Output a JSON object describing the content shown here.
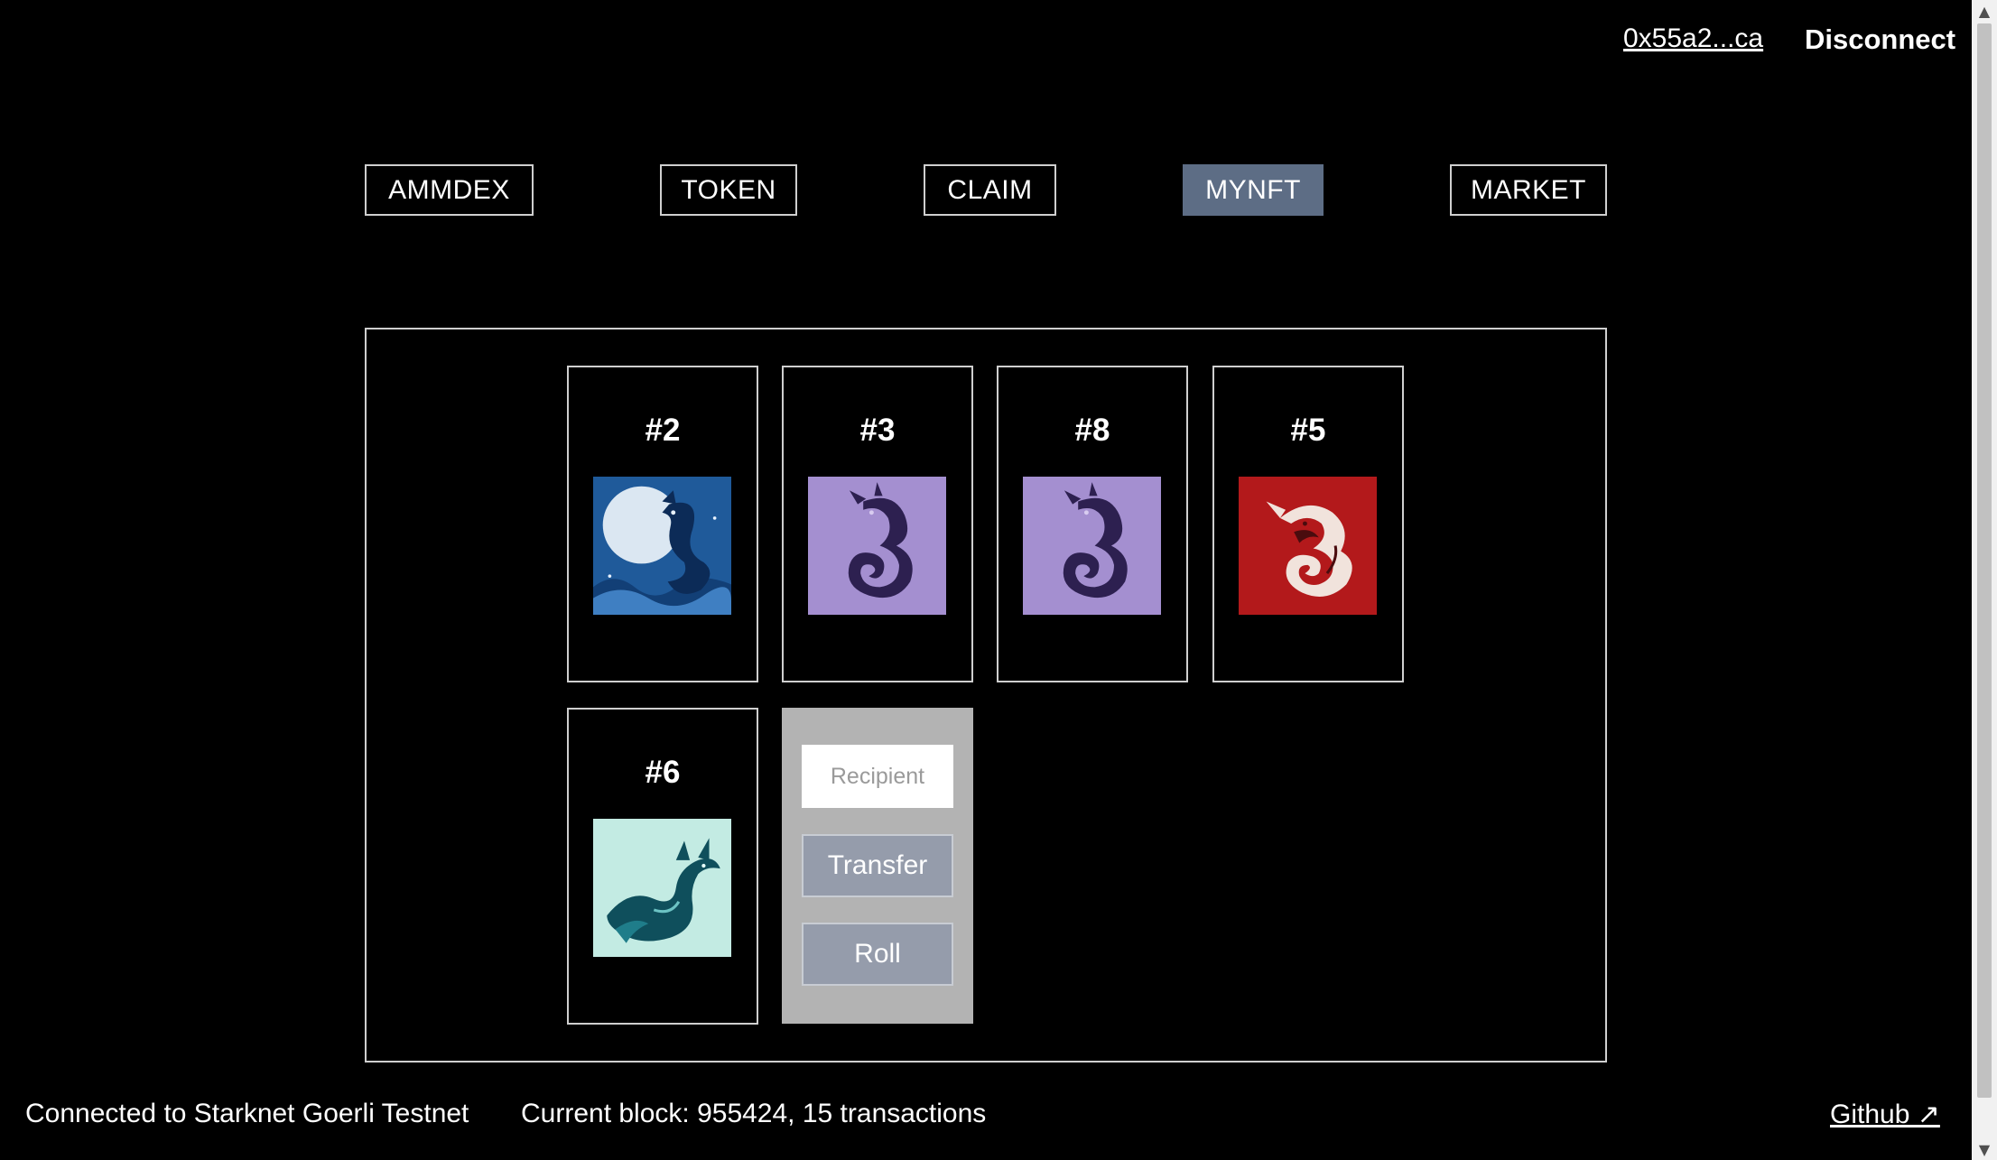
{
  "header": {
    "wallet_address": "0x55a2...ca",
    "disconnect_label": "Disconnect"
  },
  "nav": {
    "items": [
      {
        "label": "AMMDEX",
        "active": false
      },
      {
        "label": "TOKEN",
        "active": false
      },
      {
        "label": "CLAIM",
        "active": false
      },
      {
        "label": "MYNFT",
        "active": true
      },
      {
        "label": "MARKET",
        "active": false
      }
    ]
  },
  "nfts": [
    {
      "title": "#2",
      "image_icon": "blue-dragon-moon-image",
      "bg_color": "#1f5a9a"
    },
    {
      "title": "#3",
      "image_icon": "purple-dragon-image",
      "bg_color": "#a48fd0"
    },
    {
      "title": "#8",
      "image_icon": "purple-dragon-image",
      "bg_color": "#a48fd0"
    },
    {
      "title": "#5",
      "image_icon": "red-dragon-image",
      "bg_color": "#b3191b"
    },
    {
      "title": "#6",
      "image_icon": "teal-dragon-image",
      "bg_color": "#c3ebe3"
    }
  ],
  "actions": {
    "recipient_placeholder": "Recipient",
    "transfer_label": "Transfer",
    "roll_label": "Roll"
  },
  "footer": {
    "network_status": "Connected to Starknet Goerli Testnet",
    "block_info": "Current block: 955424, 15 transactions",
    "github_label": "Github ↗"
  },
  "colors": {
    "background": "#000000",
    "active_nav": "#5d6d85",
    "action_panel": "#b3b3b3",
    "action_button": "#959cab"
  }
}
